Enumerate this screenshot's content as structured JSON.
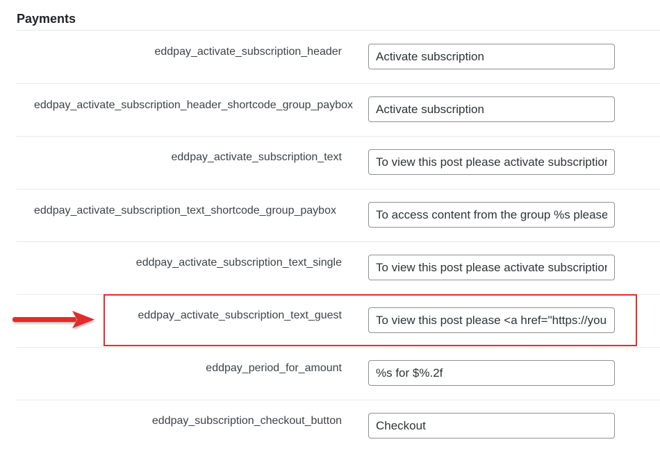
{
  "section": {
    "title": "Payments"
  },
  "rows": [
    {
      "label": "eddpay_activate_subscription_header",
      "value": "Activate subscription"
    },
    {
      "label": "eddpay_activate_subscription_header_shortcode_group_paybox",
      "value": "Activate subscription"
    },
    {
      "label": "eddpay_activate_subscription_text",
      "value": "To view this post please activate subscription"
    },
    {
      "label": "eddpay_activate_subscription_text_shortcode_group_paybox",
      "value": "To access content from the group %s please activate subscription"
    },
    {
      "label": "eddpay_activate_subscription_text_single",
      "value": "To view this post please activate subscription"
    },
    {
      "label": "eddpay_activate_subscription_text_guest",
      "value": "To view this post please <a href=\"https://your-site.com\">"
    },
    {
      "label": "eddpay_period_for_amount",
      "value": "%s for $%.2f"
    },
    {
      "label": "eddpay_subscription_checkout_button",
      "value": "Checkout"
    }
  ],
  "annotation": {
    "highlighted_row": "eddpay_activate_subscription_text_guest",
    "color": "#e32b2b",
    "arrow_icon": "arrow-right-icon"
  },
  "colors": {
    "label": "#3c434a",
    "input_border": "#8c8f94",
    "divider": "#e8e8e8",
    "highlight": "#e32b2b"
  }
}
